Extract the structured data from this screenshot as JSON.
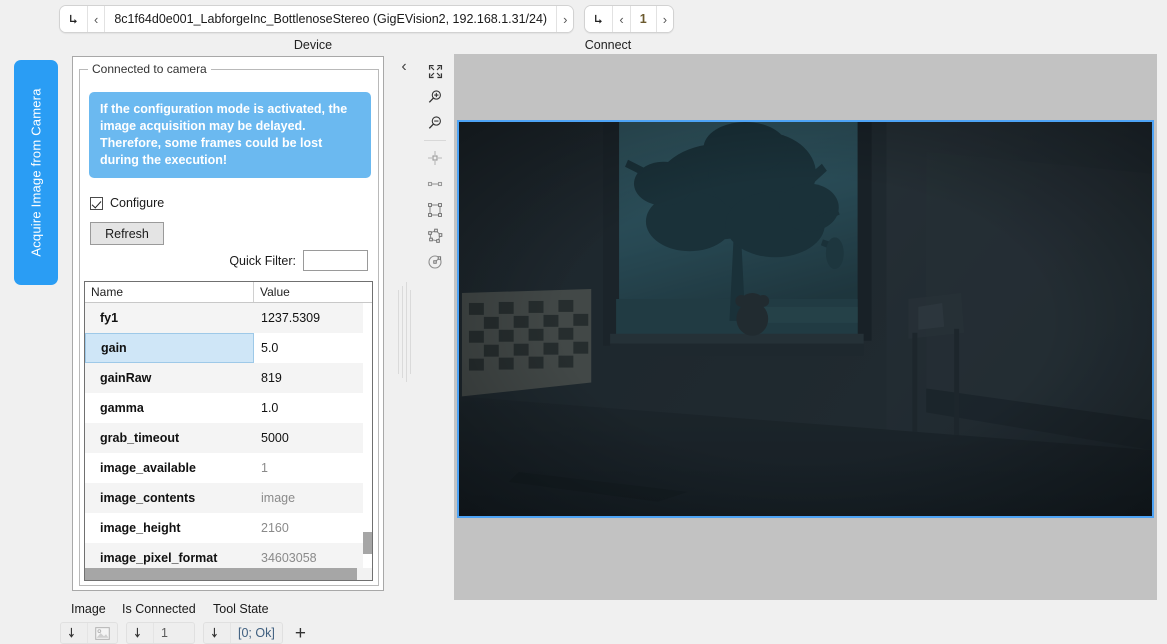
{
  "activity_tab": {
    "label": "Acquire Image from Camera"
  },
  "nav": {
    "device": {
      "caption": "Device",
      "goto_icon": "goto-arrow-icon",
      "prev_icon": "chevron-left-icon",
      "value": "8c1f64d0e001_LabforgeInc_BottlenoseStereo (GigEVision2, 192.168.1.31/24)",
      "next_icon": "chevron-right-icon"
    },
    "connect": {
      "caption": "Connect",
      "goto_icon": "goto-arrow-icon",
      "prev_icon": "chevron-left-icon",
      "value": "1",
      "next_icon": "chevron-right-icon"
    }
  },
  "panel": {
    "group_title": "Connected to camera",
    "notice": "If the configuration mode is activated, the image acquisition may be delayed. Therefore, some frames could be lost during the execution!",
    "notice_color": "#6bb9f0",
    "configure_label": "Configure",
    "configure_checked": true,
    "refresh_label": "Refresh",
    "quick_filter_label": "Quick Filter:",
    "quick_filter_value": "",
    "quick_filter_placeholder": ""
  },
  "table": {
    "columns": [
      "Name",
      "Value"
    ],
    "selected_row": "gain",
    "selection_color": "#cfe6f7",
    "rows": [
      {
        "name": "fy1",
        "value": "1237.5309",
        "dim": false
      },
      {
        "name": "gain",
        "value": "5.0",
        "dim": false
      },
      {
        "name": "gainRaw",
        "value": "819",
        "dim": false
      },
      {
        "name": "gamma",
        "value": "1.0",
        "dim": false
      },
      {
        "name": "grab_timeout",
        "value": "5000",
        "dim": false
      },
      {
        "name": "image_available",
        "value": "1",
        "dim": true
      },
      {
        "name": "image_contents",
        "value": "image",
        "dim": true
      },
      {
        "name": "image_height",
        "value": "2160",
        "dim": true
      },
      {
        "name": "image_pixel_format",
        "value": "34603058",
        "dim": true
      }
    ]
  },
  "toolrail": {
    "collapse_icon": "chevron-left-icon",
    "tools": [
      {
        "icon": "fit-to-screen-icon",
        "name": "fit-to-screen-tool"
      },
      {
        "icon": "zoom-in-icon",
        "name": "zoom-in-tool"
      },
      {
        "icon": "zoom-out-icon",
        "name": "zoom-out-tool"
      },
      {
        "icon": "point-roi-icon",
        "name": "point-roi-tool"
      },
      {
        "icon": "line-roi-icon",
        "name": "line-roi-tool"
      },
      {
        "icon": "rectangle-roi-icon",
        "name": "rectangle-roi-tool"
      },
      {
        "icon": "polygon-roi-icon",
        "name": "polygon-roi-tool"
      },
      {
        "icon": "circle-roi-icon",
        "name": "circle-roi-tool"
      }
    ]
  },
  "canvas": {
    "background_color": "#c2c2c2",
    "image_border_color": "#4da3f5",
    "image_description": "Dark low-light camera frame of a room interior with a bright window showing a silhouetted tree, a checkerboard calibration target at the left and a teddy bear on the sill"
  },
  "status_bar": {
    "headers": [
      "Image",
      "Is Connected",
      "Tool State"
    ],
    "image": {
      "goto_icon": "goto-arrow-icon",
      "thumb_icon": "image-thumbnail-icon"
    },
    "is_connected": {
      "goto_icon": "goto-arrow-icon",
      "value": "1"
    },
    "tool_state": {
      "goto_icon": "goto-arrow-icon",
      "value": "[0; Ok]"
    },
    "add_label": "+"
  }
}
